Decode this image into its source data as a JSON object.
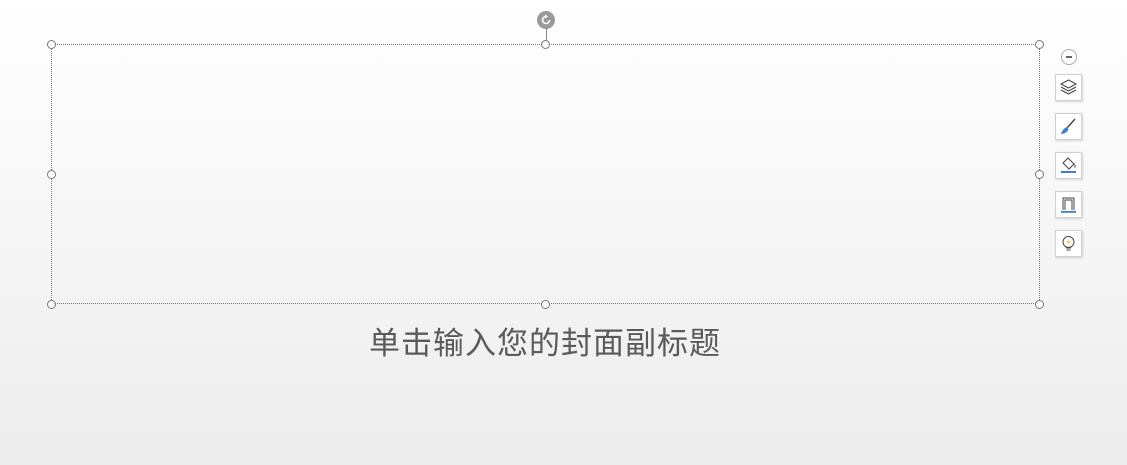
{
  "slide": {
    "subtitle_placeholder": "单击输入您的封面副标题"
  },
  "side_toolbar": {
    "buttons": [
      {
        "name": "layers-icon"
      },
      {
        "name": "brush-icon"
      },
      {
        "name": "fill-bucket-icon"
      },
      {
        "name": "border-frame-icon"
      },
      {
        "name": "lightbulb-icon"
      }
    ]
  },
  "colors": {
    "accent_blue": "#3b7fd6",
    "lightbulb_yellow": "#e8b400",
    "subtitle_text": "#5a5a5a"
  }
}
